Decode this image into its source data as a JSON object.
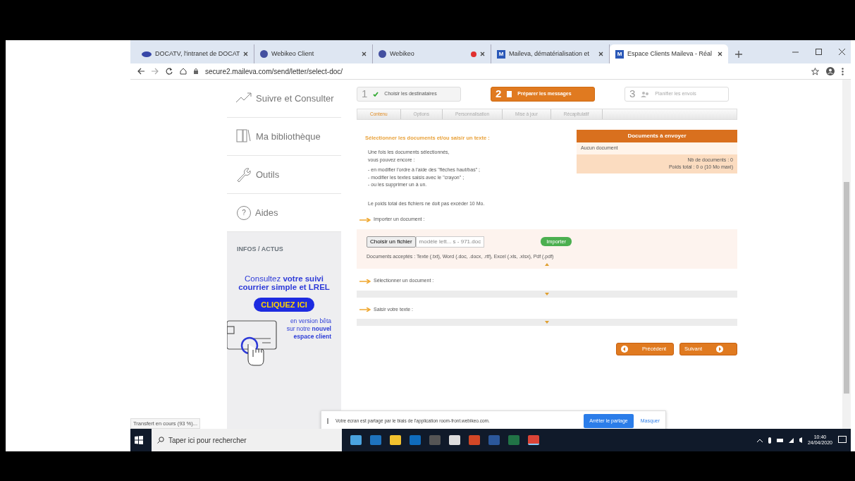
{
  "browser": {
    "tabs": [
      {
        "title": "DOCATV, l'intranet de DOCAT",
        "selected": false,
        "kind": "logo",
        "recording": false
      },
      {
        "title": "Webikeo Client",
        "selected": false,
        "kind": "round",
        "recording": false
      },
      {
        "title": "Webikeo",
        "selected": false,
        "kind": "round",
        "recording": true
      },
      {
        "title": "Maileva, dématérialisation et",
        "selected": false,
        "kind": "letter",
        "icon_text": "M",
        "recording": false
      },
      {
        "title": "Espace Clients Maileva - Réal",
        "selected": true,
        "kind": "letter",
        "icon_text": "M",
        "recording": false
      }
    ],
    "address": "secure2.maileva.com/send/letter/select-doc/"
  },
  "sidebar": {
    "nav": [
      {
        "label": "Suivre et Consulter",
        "kind": "chart"
      },
      {
        "label": "Ma bibliothèque",
        "kind": "book"
      },
      {
        "label": "Outils",
        "kind": "wrench"
      },
      {
        "label": "Aides",
        "kind": "help",
        "icon_text": "?"
      }
    ],
    "infos": {
      "title": "INFOS / ACTUS",
      "promo": "Consultez **votre suivi courrier simple et LREL**",
      "cta": "CLIQUEZ ICI",
      "footer": "en version bêta sur notre **nouvel espace client**"
    }
  },
  "steps": [
    {
      "number": "1",
      "label": "Choisir les destinataires",
      "kind": "done"
    },
    {
      "number": "2",
      "label": "Préparer les messages",
      "kind": "active"
    },
    {
      "number": "3",
      "label": "Planifier les envois",
      "kind": "pending"
    }
  ],
  "subtabs": [
    {
      "label": "Contenu",
      "selected": true
    },
    {
      "label": "Options",
      "selected": false
    },
    {
      "label": "Personnalisation",
      "selected": false
    },
    {
      "label": "Mise à jour",
      "selected": false
    },
    {
      "label": "Récapitulatif",
      "selected": false
    }
  ],
  "intro": {
    "heading": "Sélectionner les documents et/ou saisir un texte :",
    "lead": "Une fois les documents sélectionnés,",
    "lead2": "vous pouvez encore :",
    "bullets": [
      "- en modifier l'ordre à l'aide des \"flèches haut/bas\" ;",
      "- modifier les textes saisis avec le \"crayon\" ;",
      "- ou les supprimer un à un."
    ],
    "limit": "Le poids total des fichiers ne doit pas excéder 10 Mo."
  },
  "documents_box": {
    "title": "Documents à envoyer",
    "empty": "Aucun document",
    "count": "Nb de documents : 0",
    "weight": "Poids total : 0 o (10 Mo maxi)"
  },
  "sections": [
    {
      "title": "Importer un document :",
      "expanded": true,
      "file_button": "Choisir un fichier",
      "file_name": "modèle lett... s - 971.doc",
      "import_button": "Importer",
      "accepted": "Documents acceptés : Texte (.txt), Word (.doc, .docx, .rtf), Excel (.xls, .xlsx), Pdf (.pdf)"
    },
    {
      "title": "Sélectionner un document :",
      "expanded": false
    },
    {
      "title": "Saisir votre texte :",
      "expanded": false
    }
  ],
  "nav_buttons": [
    {
      "label": "Précédent",
      "kind": "back"
    },
    {
      "label": "Suivant",
      "kind": "next"
    }
  ],
  "status_bar": "Transfert en cours (93 %)...",
  "share_bar": {
    "message": "Votre écran est partagé par le biais de l'application room-front.webikeo.com.",
    "stop_button": "Arrêter le partage",
    "hide_link": "Masquer"
  },
  "taskbar": {
    "search_placeholder": "Taper ici pour rechercher",
    "time": "10:40",
    "date": "24/04/2020",
    "apps": [
      {
        "color": "#4aa3df",
        "active": false
      },
      {
        "color": "#1e73be",
        "active": false
      },
      {
        "color": "#f2c12e",
        "active": false
      },
      {
        "color": "#0f6cbd",
        "active": false
      },
      {
        "color": "#555555",
        "active": false
      },
      {
        "color": "#dddddd",
        "active": false
      },
      {
        "color": "#d24726",
        "active": false
      },
      {
        "color": "#2b579a",
        "active": false
      },
      {
        "color": "#217346",
        "active": false
      },
      {
        "color": "#db4437",
        "active": true
      }
    ]
  }
}
